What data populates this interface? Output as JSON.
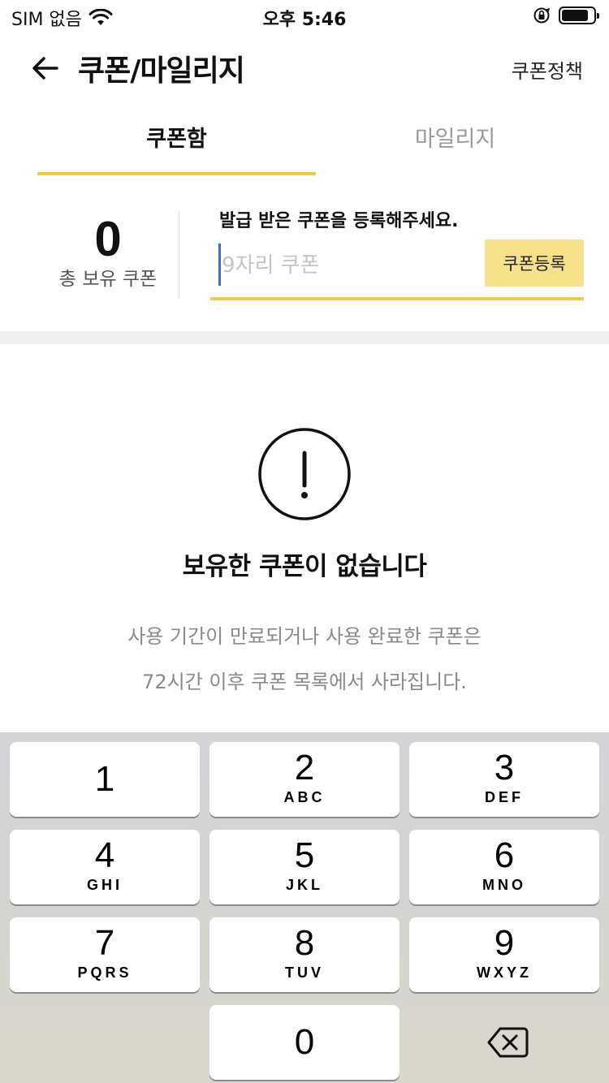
{
  "status_bar": {
    "carrier": "SIM 없음",
    "time": "오후 5:46"
  },
  "header": {
    "title": "쿠폰/마일리지",
    "policy_link": "쿠폰정책"
  },
  "tabs": [
    {
      "label": "쿠폰함",
      "active": true
    },
    {
      "label": "마일리지",
      "active": false
    }
  ],
  "coupon_summary": {
    "count": "0",
    "count_label": "총 보유 쿠폰"
  },
  "register": {
    "guide": "발급 받은 쿠폰을 등록해주세요.",
    "placeholder": "9자리 쿠폰",
    "button_label": "쿠폰등록"
  },
  "empty_state": {
    "icon": "alert-circle-icon",
    "title": "보유한 쿠폰이 없습니다",
    "desc_line1": "사용 기간이 만료되거나 사용 완료한 쿠폰은",
    "desc_line2": "72시간 이후 쿠폰 목록에서 사라집니다."
  },
  "keypad": {
    "keys": [
      {
        "num": "1",
        "letters": ""
      },
      {
        "num": "2",
        "letters": "ABC"
      },
      {
        "num": "3",
        "letters": "DEF"
      },
      {
        "num": "4",
        "letters": "GHI"
      },
      {
        "num": "5",
        "letters": "JKL"
      },
      {
        "num": "6",
        "letters": "MNO"
      },
      {
        "num": "7",
        "letters": "PQRS"
      },
      {
        "num": "8",
        "letters": "TUV"
      },
      {
        "num": "9",
        "letters": "WXYZ"
      },
      {
        "num": "0",
        "letters": ""
      }
    ],
    "delete_icon": "backspace-icon"
  },
  "colors": {
    "accent": "#f2c84b",
    "button_bg": "#f7e08a",
    "caret": "#3b6ae0"
  }
}
